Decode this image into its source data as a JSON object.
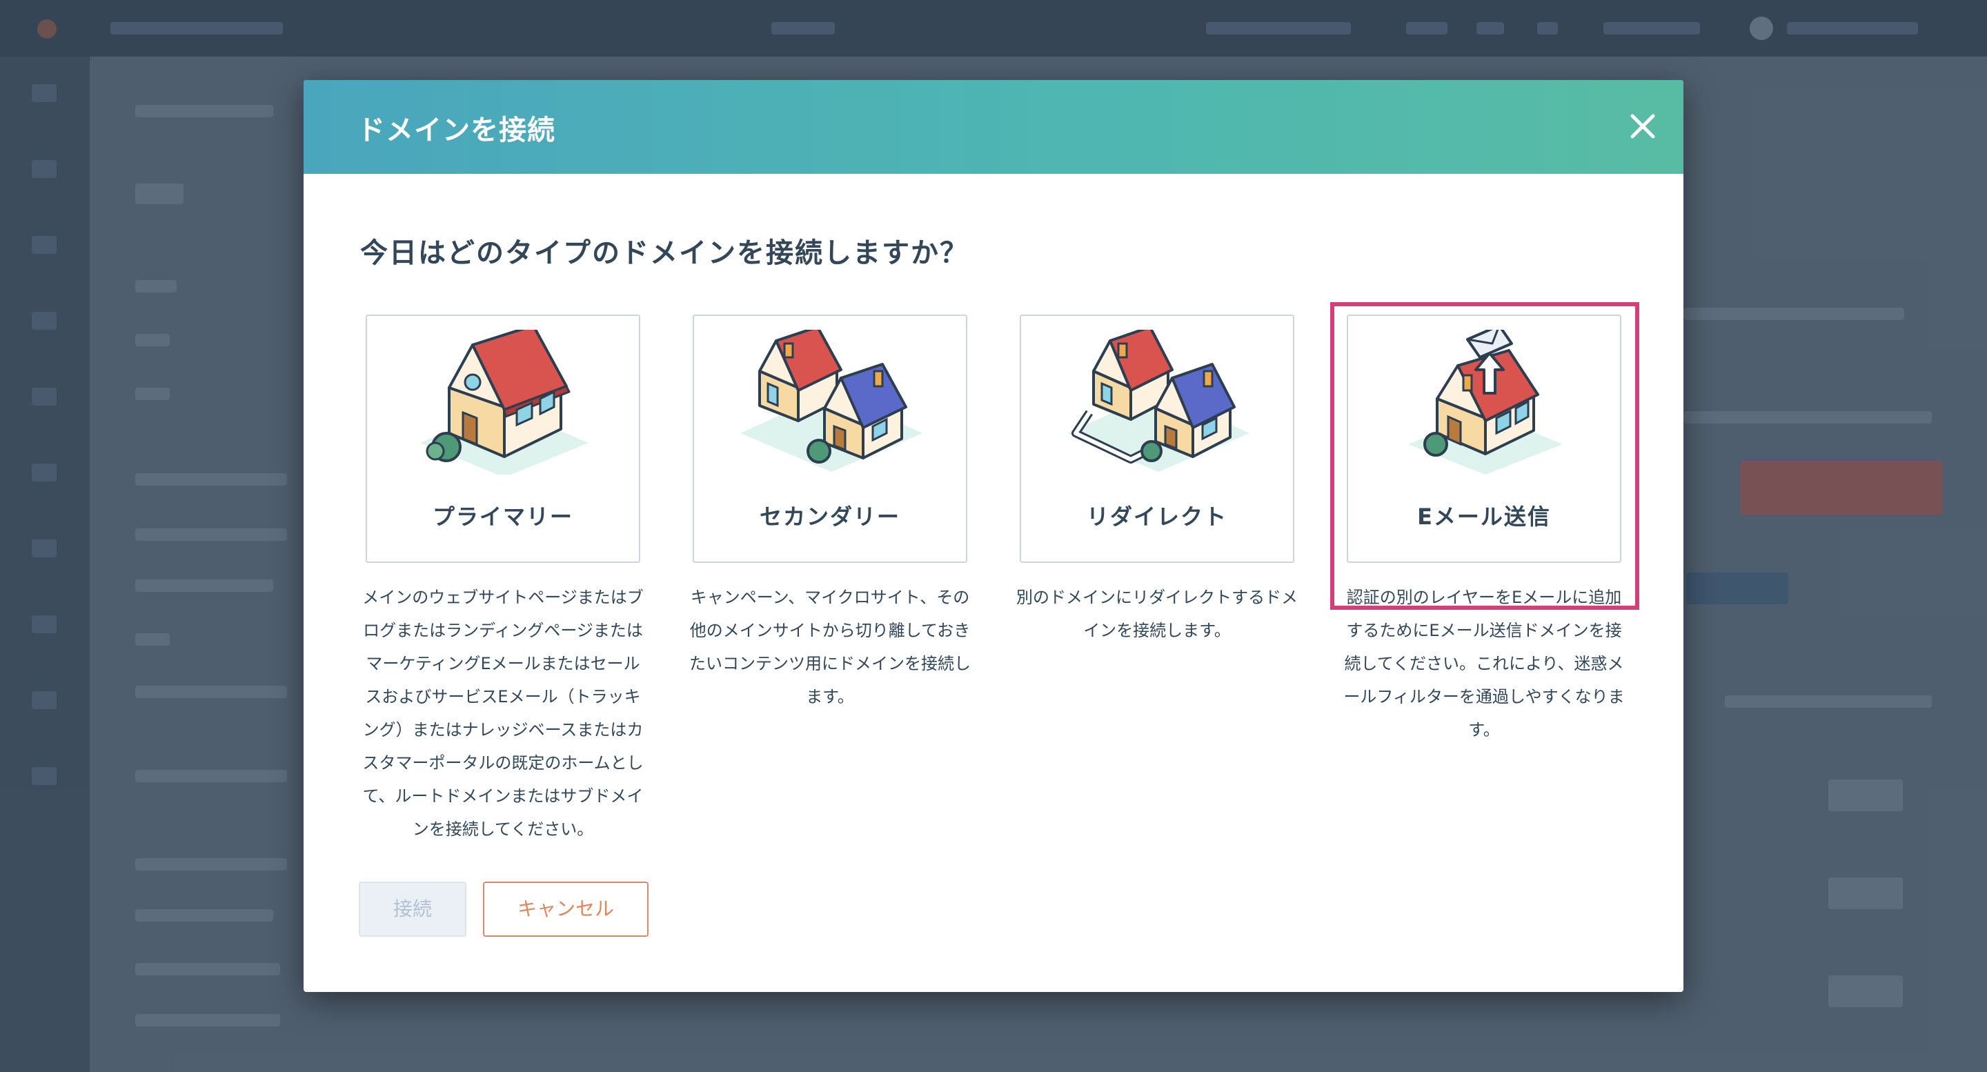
{
  "modal": {
    "title": "ドメインを接続",
    "question": "今日はどのタイプのドメインを接続しますか？",
    "options": [
      {
        "label": "プライマリー",
        "description": "メインのウェブサイトページまたはブログまたはランディングページまたはマーケティングEメールまたはセールスおよびサービスEメール（トラッキング）またはナレッジベースまたはカスタマーポータルの既定のホームとして、ルートドメインまたはサブドメインを接続してください。",
        "icon": "house-icon"
      },
      {
        "label": "セカンダリー",
        "description": "キャンペーン、マイクロサイト、その他のメインサイトから切り離しておきたいコンテンツ用にドメインを接続します。",
        "icon": "two-houses-icon"
      },
      {
        "label": "リダイレクト",
        "description": "別のドメインにリダイレクトするドメインを接続します。",
        "icon": "redirect-houses-icon"
      },
      {
        "label": "Eメール送信",
        "description": "認証の別のレイヤーをEメールに追加するためにEメール送信ドメインを接続してください。これにより、迷惑メールフィルターを通過しやすくなります。",
        "icon": "email-house-icon",
        "highlighted": true
      }
    ],
    "buttons": {
      "connect": "接続",
      "cancel": "キャンセル"
    }
  },
  "colors": {
    "header_start": "#4aa6bd",
    "header_end": "#58bca4",
    "highlight": "#d43f7a",
    "cancel": "#e0865a",
    "text": "#33475b"
  }
}
